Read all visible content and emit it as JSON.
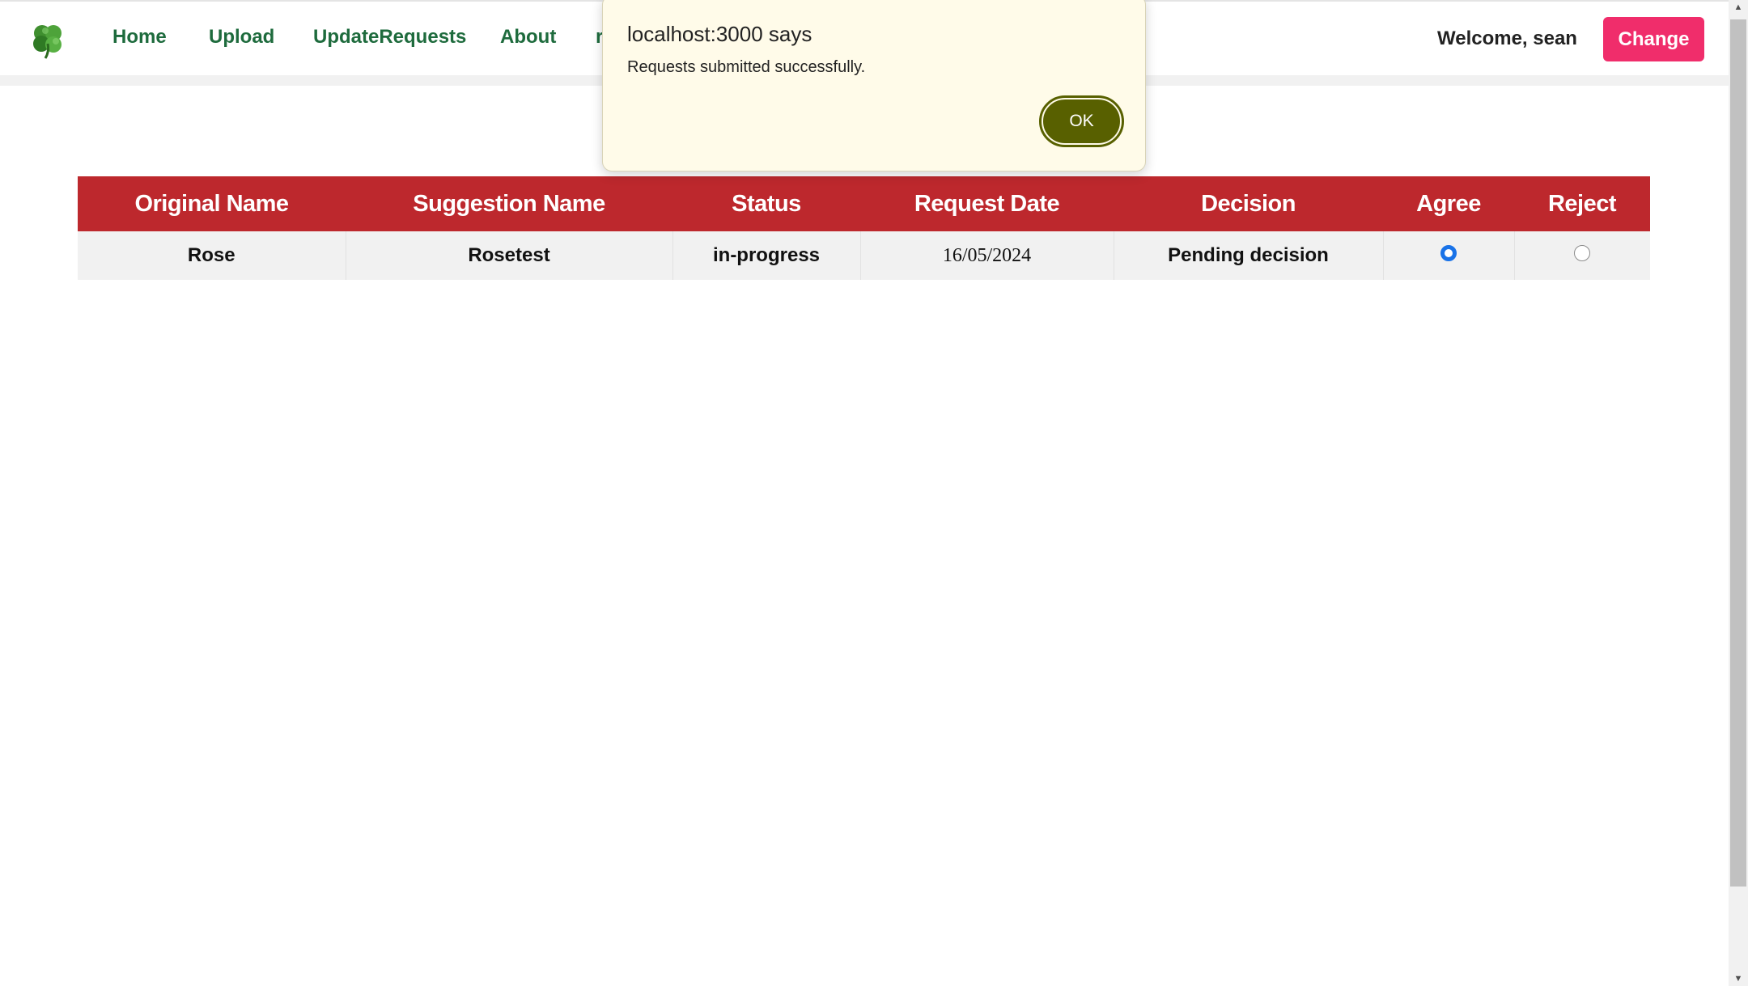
{
  "nav": {
    "logo_icon": "shamrock-icon",
    "links": [
      "Home",
      "Upload",
      "UpdateRequests",
      "About",
      "r"
    ],
    "welcome_text": "Welcome, sean",
    "change_label": "Change"
  },
  "table": {
    "headers": [
      "Original Name",
      "Suggestion Name",
      "Status",
      "Request Date",
      "Decision",
      "Agree",
      "Reject"
    ],
    "rows": [
      {
        "original_name": "Rose",
        "suggestion_name": "Rosetest",
        "status": "in-progress",
        "request_date": "16/05/2024",
        "decision": "Pending decision",
        "agree_selected": true,
        "reject_selected": false
      }
    ]
  },
  "dialog": {
    "title": "localhost:3000 says",
    "message": "Requests submitted successfully.",
    "ok_label": "OK"
  },
  "colors": {
    "table_header": "#bd282d",
    "nav_link": "#1e6b3d",
    "change_button": "#f02d6b",
    "ok_button": "#586000",
    "dialog_bg": "#fffbe9"
  }
}
